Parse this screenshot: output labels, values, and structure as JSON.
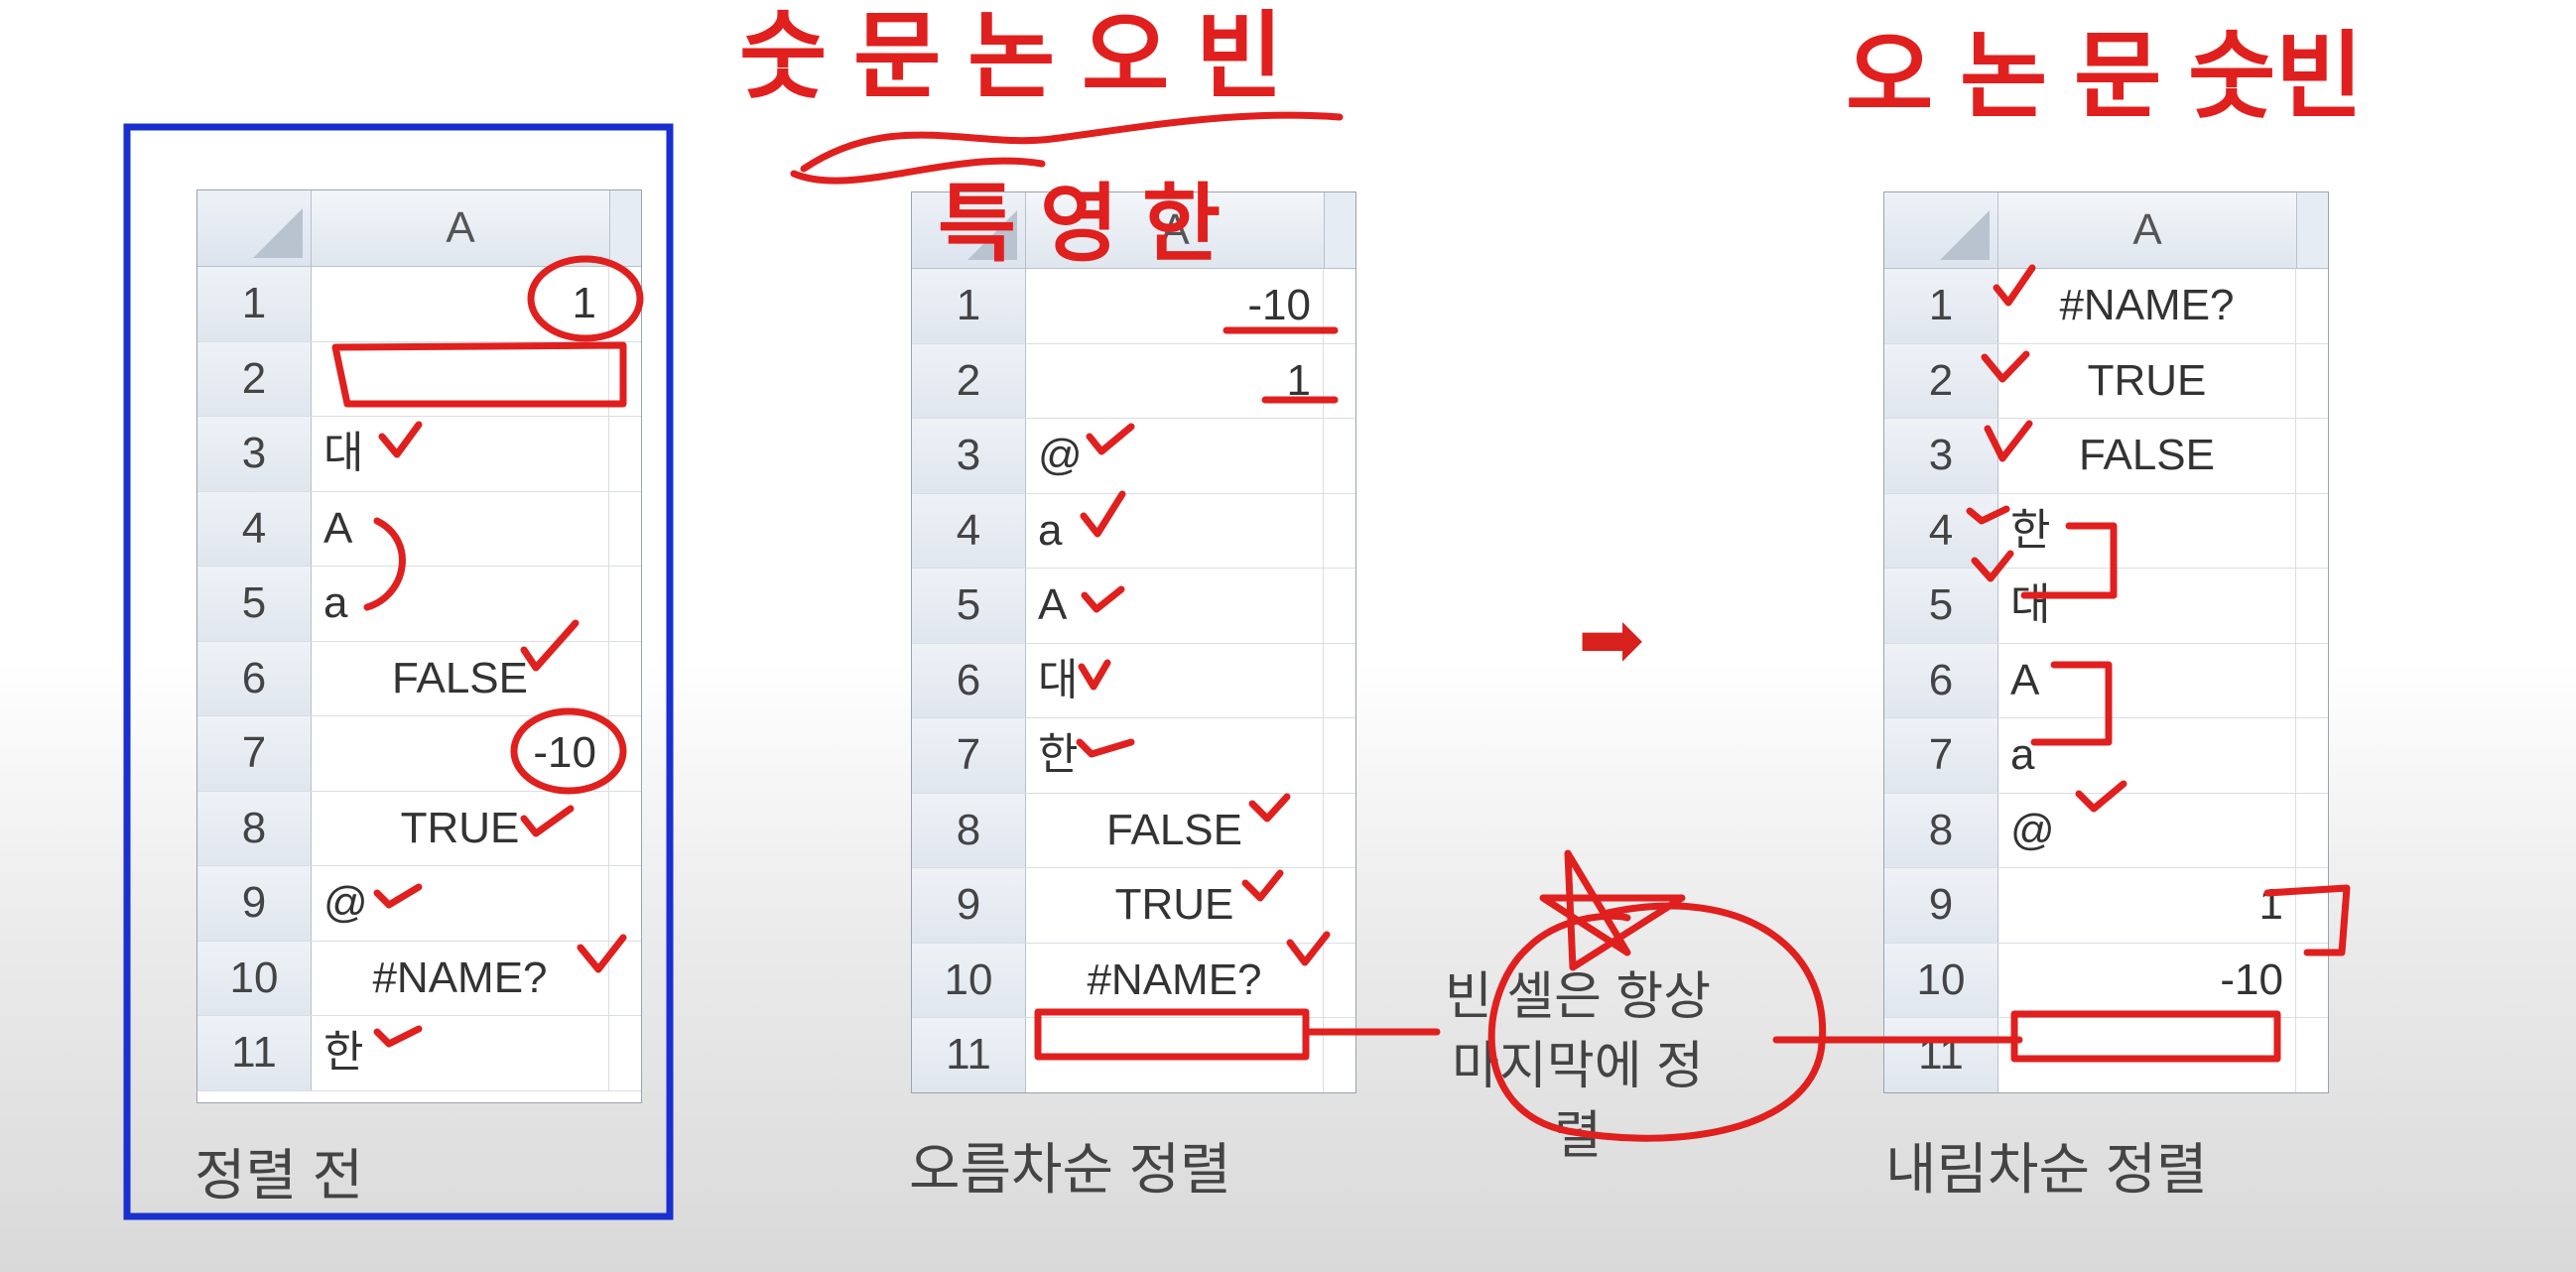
{
  "column_header": "A",
  "tables": [
    {
      "caption": "정렬 전",
      "rows": [
        {
          "n": "1",
          "v": "1",
          "align": "right"
        },
        {
          "n": "2",
          "v": "",
          "align": "left"
        },
        {
          "n": "3",
          "v": "대",
          "align": "left"
        },
        {
          "n": "4",
          "v": "A",
          "align": "left"
        },
        {
          "n": "5",
          "v": "a",
          "align": "left"
        },
        {
          "n": "6",
          "v": "FALSE",
          "align": "center"
        },
        {
          "n": "7",
          "v": "-10",
          "align": "right"
        },
        {
          "n": "8",
          "v": "TRUE",
          "align": "center"
        },
        {
          "n": "9",
          "v": "@",
          "align": "left"
        },
        {
          "n": "10",
          "v": "#NAME?",
          "align": "center"
        },
        {
          "n": "11",
          "v": "한",
          "align": "left"
        }
      ]
    },
    {
      "caption": "오름차순 정렬",
      "rows": [
        {
          "n": "1",
          "v": "-10",
          "align": "right"
        },
        {
          "n": "2",
          "v": "1",
          "align": "right"
        },
        {
          "n": "3",
          "v": "@",
          "align": "left"
        },
        {
          "n": "4",
          "v": "a",
          "align": "left"
        },
        {
          "n": "5",
          "v": "A",
          "align": "left"
        },
        {
          "n": "6",
          "v": "대",
          "align": "left"
        },
        {
          "n": "7",
          "v": "한",
          "align": "left"
        },
        {
          "n": "8",
          "v": "FALSE",
          "align": "center"
        },
        {
          "n": "9",
          "v": "TRUE",
          "align": "center"
        },
        {
          "n": "10",
          "v": "#NAME?",
          "align": "center"
        },
        {
          "n": "11",
          "v": "",
          "align": "left"
        }
      ]
    },
    {
      "caption": "내림차순 정렬",
      "rows": [
        {
          "n": "1",
          "v": "#NAME?",
          "align": "center"
        },
        {
          "n": "2",
          "v": "TRUE",
          "align": "center"
        },
        {
          "n": "3",
          "v": "FALSE",
          "align": "center"
        },
        {
          "n": "4",
          "v": "한",
          "align": "left"
        },
        {
          "n": "5",
          "v": "대",
          "align": "left"
        },
        {
          "n": "6",
          "v": "A",
          "align": "left"
        },
        {
          "n": "7",
          "v": "a",
          "align": "left"
        },
        {
          "n": "8",
          "v": "@",
          "align": "left"
        },
        {
          "n": "9",
          "v": "1",
          "align": "right"
        },
        {
          "n": "10",
          "v": "-10",
          "align": "right"
        },
        {
          "n": "11",
          "v": "",
          "align": "left"
        }
      ]
    }
  ],
  "note": {
    "line1": "빈 셀은 항상",
    "line2": "마지막에 정렬"
  },
  "handwriting": {
    "top_left": "숫 문 논 오 빈",
    "under": "특 영 한",
    "top_right": "오 논 문 숫빈"
  },
  "arrow_glyph": "➡",
  "colors": {
    "ink": "#e0201e",
    "frame": "#1a2fd0",
    "grid": "#9aa3ad"
  }
}
